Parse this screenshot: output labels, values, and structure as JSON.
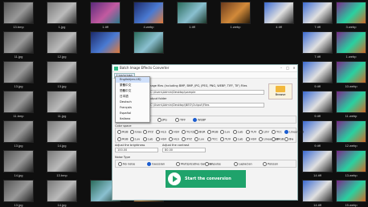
{
  "gallery": {
    "left_captions": [
      "13.bmp",
      "1.jpg",
      "11.jpg",
      "12.jpg",
      "13.jpg",
      "13.jpg",
      "11.bmp",
      "11.jpg",
      "13.jpg",
      "14.jpg",
      "14.jpg",
      "13.bmp",
      "13.jpg",
      "14.jpg"
    ],
    "mid_captions": [
      "1.tiff",
      "4.webp",
      "1.tiff",
      "1.webp",
      "4.tiff",
      "5.webp"
    ],
    "right_captions": [
      "7.tiff",
      "3.webp",
      "7.tiff",
      "1.webp",
      "9.tiff",
      "10.webp",
      "9.tiff",
      "11.webp",
      "9.tiff",
      "12.webp",
      "14.tiff",
      "13.webp",
      "14.tiff",
      "15.webp",
      "14.tiff"
    ],
    "bottom_captions": [
      "13.bmp",
      "13.jpg",
      "14.jpg",
      "13.jpg",
      "13.tiff",
      "14.tiff",
      "14.webp"
    ]
  },
  "window": {
    "title": "Batch Image Effects Converter",
    "menu_language": "Language",
    "input_label": "Image files (including BMP, BMP, JPG, JPEG, PNG, WEBP, TIFF, TIF) Files",
    "input_value": "C:\\Users\\Admin\\Desktop\\sample",
    "browse_label": "Browse",
    "output_label": "Output folder",
    "output_value": "C:\\Users\\Admin\\Desktop\\NEO\\Output\\Files",
    "format_label": "Output format",
    "formats": [
      "PNG",
      "JPG",
      "TIFF",
      "WEBP"
    ],
    "format_selected": "WEBP",
    "colorspace_label": "Color space",
    "colorspaces_row1": [
      "RGB",
      "Gray",
      "XYZ",
      "HLS",
      "HSV",
      "YCrCb",
      "BGR",
      "RGB",
      "Luv",
      "Lab",
      "YUV",
      "LUV",
      "YCC",
      "LinearRGB"
    ],
    "colorspaces_row2": [
      "RGB",
      "Luv",
      "Lab",
      "HSV",
      "HLS",
      "XYZ",
      "Luv",
      "YCC",
      "YUV",
      "Lab",
      "HSV",
      "LinearRGB",
      "sRGB",
      "Bw"
    ],
    "colorspace_selected": "LinearRGB",
    "brightness_label": "Adjust the brightness",
    "brightness_value": "100.00",
    "contrast_label": "Adjust the contrast",
    "contrast_value": "80.00",
    "noise_label": "Noise Type",
    "noise_types": [
      "No noise",
      "Gaussian",
      "Multiplicative Gaussian",
      "Impulse",
      "Laplacian",
      "Poisson"
    ],
    "noise_selected": "Gaussian",
    "start_label": "Start the conversion"
  },
  "language_dropdown": {
    "items": [
      "English(en-US)",
      "繁體中文",
      "簡體中文",
      "日本語",
      "Deutsch",
      "Français",
      "Español",
      "Italiano"
    ],
    "selected": "English(en-US)"
  },
  "colors": {
    "accent": "#1fa36b",
    "selection": "#1a5ccf"
  }
}
